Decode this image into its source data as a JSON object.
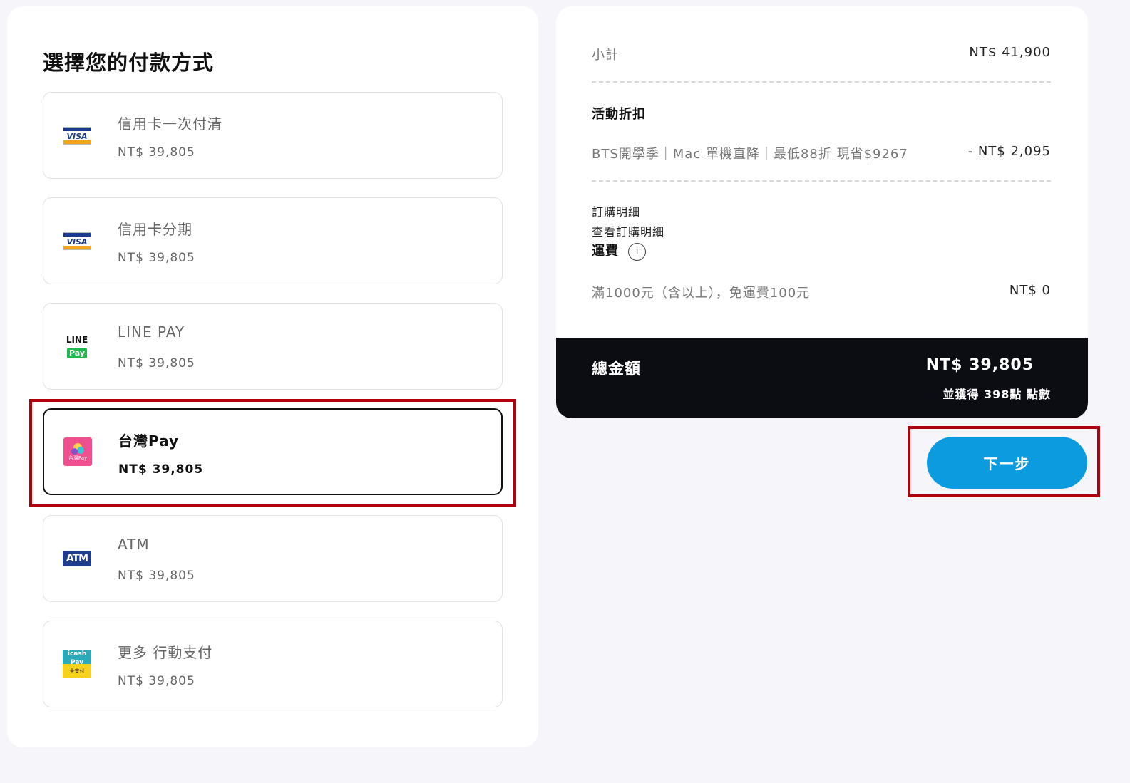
{
  "payment": {
    "title": "選擇您的付款方式",
    "methods": [
      {
        "name": "信用卡一次付清",
        "price": "NT$ 39,805",
        "icon": "visa-icon",
        "selected": false
      },
      {
        "name": "信用卡分期",
        "price": "NT$ 39,805",
        "icon": "visa-icon",
        "selected": false
      },
      {
        "name": "LINE PAY",
        "price": "NT$ 39,805",
        "icon": "line-pay-icon",
        "selected": false
      },
      {
        "name": "台灣Pay",
        "price": "NT$ 39,805",
        "icon": "taiwan-pay-icon",
        "selected": true
      },
      {
        "name": "ATM",
        "price": "NT$ 39,805",
        "icon": "atm-icon",
        "selected": false
      },
      {
        "name": "更多 行動支付",
        "price": "NT$ 39,805",
        "icon": "icash-pay-icon",
        "selected": false
      }
    ],
    "logo_text": {
      "visa": "VISA",
      "line_top": "LINE",
      "line_bottom": "Pay",
      "taiwan_pay": "台灣Pay",
      "atm": "ATM",
      "icash_top": "icash Pay",
      "icash_bottom": "全支付"
    }
  },
  "summary": {
    "subtotal_label": "小計",
    "subtotal_value": "NT$ 41,900",
    "discount_heading": "活動折扣",
    "discount_label": "BTS開學季｜Mac 單機直降｜最低88折 現省$9267",
    "discount_value": "- NT$ 2,095",
    "order_detail_label": "訂購明細",
    "order_detail_link": "查看訂購明細",
    "shipping_heading": "運費",
    "shipping_info_icon": "i",
    "shipping_label": "滿1000元（含以上），免運費100元",
    "shipping_value": "NT$ 0",
    "total_label": "總金額",
    "total_value": "NT$ 39,805",
    "points_text": "並獲得 398點 點數"
  },
  "actions": {
    "next_label": "下一步"
  },
  "colors": {
    "accent": "#0d9be0",
    "highlight": "#b0000c",
    "total_bar": "#0c0d12"
  }
}
